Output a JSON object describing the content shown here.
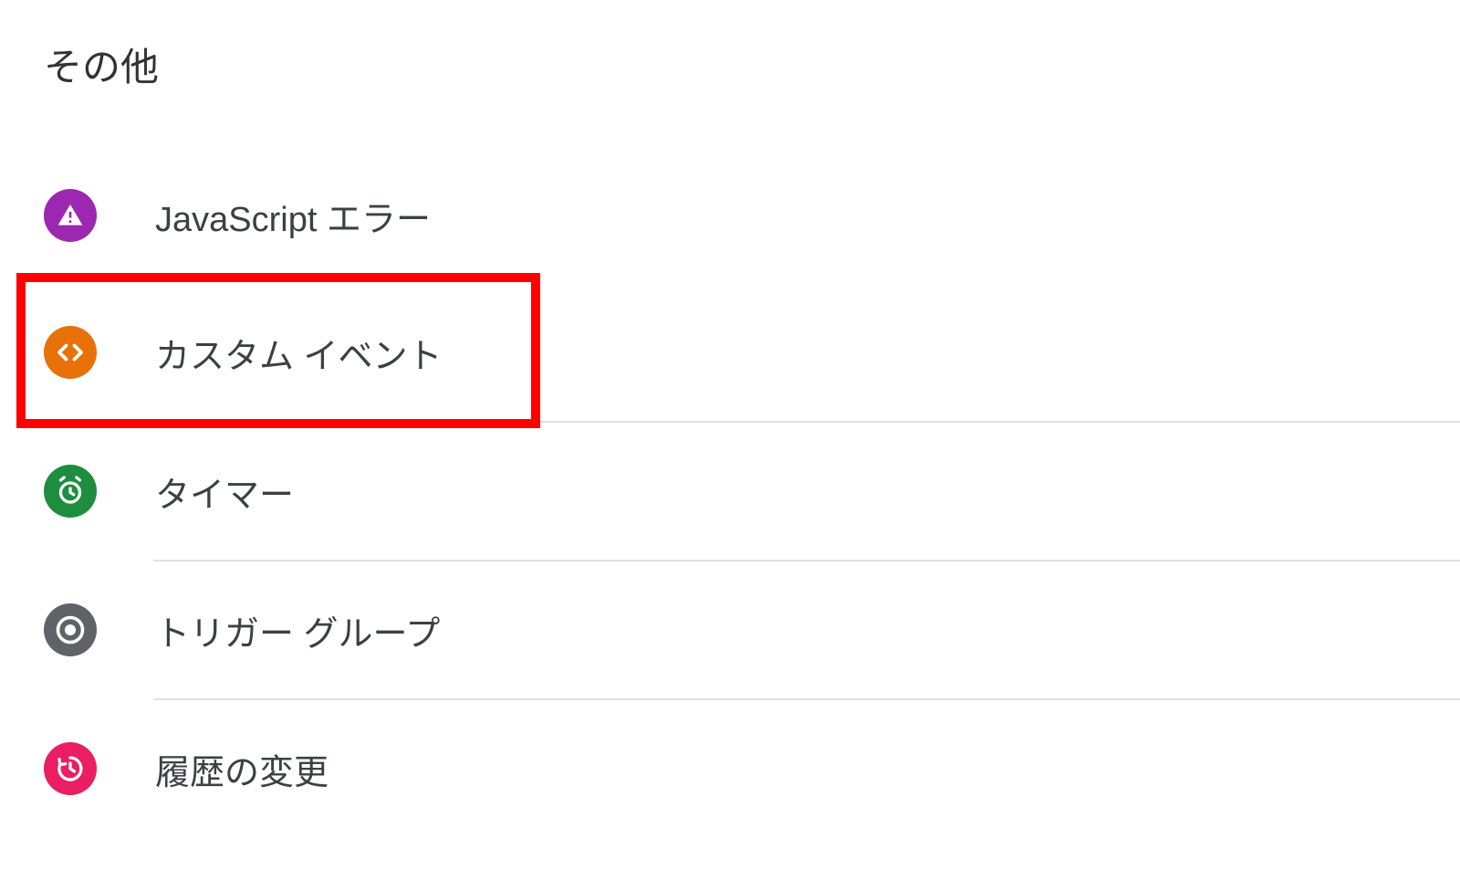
{
  "section": {
    "header": "その他",
    "items": [
      {
        "label": "JavaScript エラー",
        "icon_type": "js-error",
        "highlighted": false
      },
      {
        "label": "カスタム イベント",
        "icon_type": "custom-event",
        "highlighted": true
      },
      {
        "label": "タイマー",
        "icon_type": "timer",
        "highlighted": false
      },
      {
        "label": "トリガー グループ",
        "icon_type": "trigger-group",
        "highlighted": false
      },
      {
        "label": "履歴の変更",
        "icon_type": "history",
        "highlighted": false
      }
    ]
  },
  "colors": {
    "js_error": "#9c27b0",
    "custom_event": "#e8710a",
    "timer": "#1e8e3e",
    "trigger_group": "#5f6368",
    "history": "#e91e63",
    "highlight": "#ff0000"
  }
}
